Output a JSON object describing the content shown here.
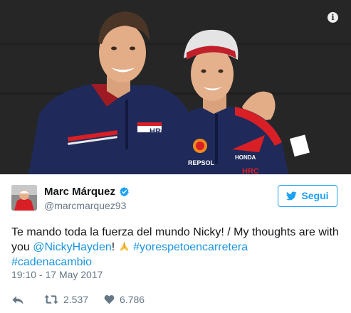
{
  "photo": {
    "kit_logo_left": "HRC",
    "kit_logo_right": "HRC",
    "sponsor_text": "REPSOL",
    "honda_text": "HONDA",
    "icons": {
      "info": "info-icon"
    }
  },
  "tweet": {
    "author_name": "Marc Márquez",
    "author_handle": "@marcmarquez93",
    "follow_label": "Segui",
    "text": {
      "part1": "Te mando toda la fuerza del mundo Nicky! / My thoughts are with you ",
      "mention": "@NickyHayden",
      "part2": "! ",
      "hashtag1": "#yorespetoencarretera",
      "hashtag2": "#cadenacambio"
    },
    "timestamp": "19:10 - 17 May 2017",
    "retweets": "2.537",
    "likes": "6.786",
    "icons": {
      "reply": "reply-icon",
      "retweet": "retweet-icon",
      "like": "heart-icon",
      "verified": "verified-badge-icon",
      "follow": "twitter-bird-icon",
      "emoji": "folded-hands-emoji"
    }
  },
  "colors": {
    "twitter_blue": "#1da1f2",
    "link_blue": "#1b95e0",
    "secondary_text": "#657786",
    "jacket_navy": "#1f2a5a",
    "honda_red": "#d81f26"
  }
}
